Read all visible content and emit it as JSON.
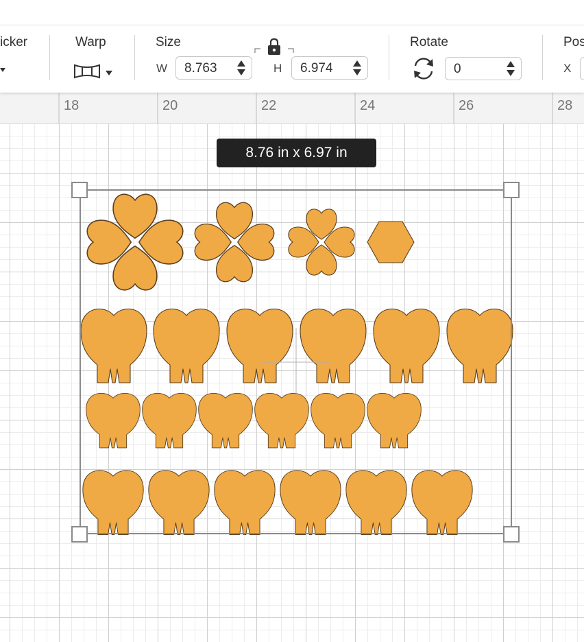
{
  "toolbar": {
    "sticker_label": "icker",
    "warp_label": "Warp",
    "size_label": "Size",
    "width_prefix": "W",
    "width_value": "8.763",
    "height_prefix": "H",
    "height_value": "6.974",
    "rotate_label": "Rotate",
    "rotate_value": "0",
    "position_label": "Pos",
    "position_x_prefix": "X"
  },
  "ruler": {
    "ticks": [
      "18",
      "20",
      "22",
      "24",
      "26",
      "28"
    ]
  },
  "canvas": {
    "size_tooltip": "8.76  in x 6.97  in",
    "shape_fill": "#efa945",
    "shape_stroke": "#5a4020",
    "selection_color": "#8a8a8a"
  },
  "icons": [
    "chevron-down-icon",
    "warp-icon",
    "lock-icon",
    "rotate-icon",
    "stepper-icon"
  ]
}
